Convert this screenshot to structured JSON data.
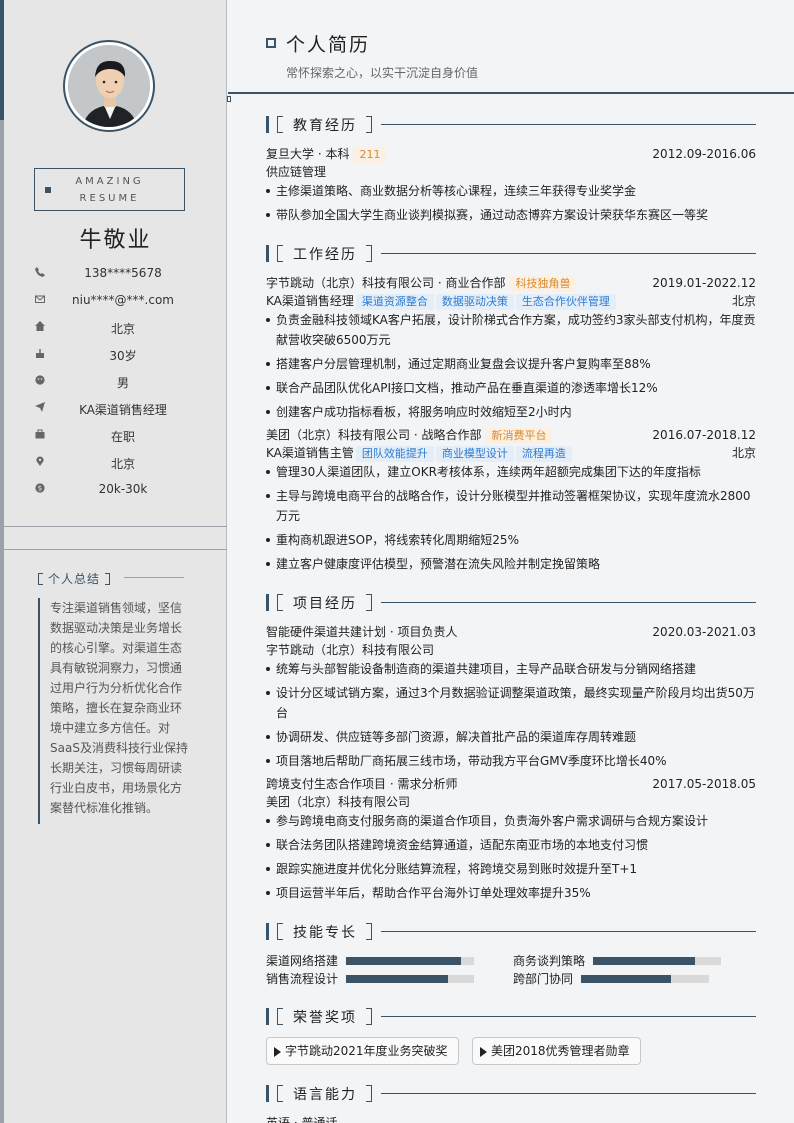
{
  "header": {
    "title": "个人简历",
    "subtitle": "常怀探索之心，以实干沉淀自身价值"
  },
  "sidebar": {
    "badge_line1": "AMAZING",
    "badge_line2": "RESUME",
    "name": "牛敬业",
    "info": [
      {
        "icon": "phone-icon",
        "value": "138****5678"
      },
      {
        "icon": "mail-icon",
        "value": "niu****@***.com"
      },
      {
        "icon": "home-icon",
        "value": "北京"
      },
      {
        "icon": "cake-icon",
        "value": "30岁"
      },
      {
        "icon": "face-icon",
        "value": "男"
      },
      {
        "icon": "send-icon",
        "value": "KA渠道销售经理"
      },
      {
        "icon": "briefcase-icon",
        "value": "在职"
      },
      {
        "icon": "location-pin-icon",
        "value": "北京"
      },
      {
        "icon": "money-icon",
        "value": "20k-30k"
      }
    ],
    "summary_title": "个人总结",
    "summary": "专注渠道销售领域，坚信数据驱动决策是业务增长的核心引擎。对渠道生态具有敏锐洞察力，习惯通过用户行为分析优化合作策略，擅长在复杂商业环境中建立多方信任。对SaaS及消费科技行业保持长期关注，习惯每周研读行业白皮书，用场景化方案替代标准化推销。"
  },
  "education": {
    "title": "教育经历",
    "school": "复旦大学 · 本科",
    "tag": "211",
    "date": "2012.09-2016.06",
    "major": "供应链管理",
    "bullets": [
      "主修渠道策略、商业数据分析等核心课程，连续三年获得专业奖学金",
      "带队参加全国大学生商业谈判模拟赛，通过动态博弈方案设计荣获华东赛区一等奖"
    ]
  },
  "work": {
    "title": "工作经历",
    "jobs": [
      {
        "company": "字节跳动（北京）科技有限公司 · 商业合作部",
        "tag": "科技独角兽",
        "date": "2019.01-2022.12",
        "role": "KA渠道销售经理",
        "skills": [
          "渠道资源整合",
          "数据驱动决策",
          "生态合作伙伴管理"
        ],
        "city": "北京",
        "bullets": [
          "负责金融科技领域KA客户拓展，设计阶梯式合作方案，成功签约3家头部支付机构，年度贡献营收突破6500万元",
          "搭建客户分层管理机制，通过定期商业复盘会议提升客户复购率至88%",
          "联合产品团队优化API接口文档，推动产品在垂直渠道的渗透率增长12%",
          "创建客户成功指标看板，将服务响应时效缩短至2小时内"
        ]
      },
      {
        "company": "美团（北京）科技有限公司 · 战略合作部",
        "tag": "新消费平台",
        "date": "2016.07-2018.12",
        "role": "KA渠道销售主管",
        "skills": [
          "团队效能提升",
          "商业模型设计",
          "流程再造"
        ],
        "city": "北京",
        "bullets": [
          "管理30人渠道团队，建立OKR考核体系，连续两年超额完成集团下达的年度指标",
          "主导与跨境电商平台的战略合作，设计分账模型并推动签署框架协议，实现年度流水2800万元",
          "重构商机跟进SOP，将线索转化周期缩短25%",
          "建立客户健康度评估模型，预警潜在流失风险并制定挽留策略"
        ]
      }
    ]
  },
  "projects": {
    "title": "项目经历",
    "items": [
      {
        "name": "智能硬件渠道共建计划 · 项目负责人",
        "date": "2020.03-2021.03",
        "org": "字节跳动（北京）科技有限公司",
        "bullets": [
          "统筹与头部智能设备制造商的渠道共建项目，主导产品联合研发与分销网络搭建",
          "设计分区域试销方案，通过3个月数据验证调整渠道政策，最终实现量产阶段月均出货50万台",
          "协调研发、供应链等多部门资源，解决首批产品的渠道库存周转难题",
          "项目落地后帮助厂商拓展三线市场，带动我方平台GMV季度环比增长40%"
        ]
      },
      {
        "name": "跨境支付生态合作项目 · 需求分析师",
        "date": "2017.05-2018.05",
        "org": "美团（北京）科技有限公司",
        "bullets": [
          "参与跨境电商支付服务商的渠道合作项目，负责海外客户需求调研与合规方案设计",
          "联合法务团队搭建跨境资金结算通道，适配东南亚市场的本地支付习惯",
          "跟踪实施进度并优化分账结算流程，将跨境交易到账时效提升至T+1",
          "项目运营半年后，帮助合作平台海外订单处理效率提升35%"
        ]
      }
    ]
  },
  "skills": {
    "title": "技能专长",
    "items": [
      {
        "name": "渠道网络搭建",
        "level": 0.9
      },
      {
        "name": "商务谈判策略",
        "level": 0.8
      },
      {
        "name": "销售流程设计",
        "level": 0.8
      },
      {
        "name": "跨部门协同",
        "level": 0.7
      }
    ]
  },
  "honors": {
    "title": "荣誉奖项",
    "items": [
      "字节跳动2021年度业务突破奖",
      "美团2018优秀管理者勋章"
    ]
  },
  "languages": {
    "title": "语言能力",
    "text": "英语 · 普通话"
  },
  "colors": {
    "accent": "#3a5366",
    "tag_orange": "#d98a2b",
    "tag_blue": "#2e7bcf"
  }
}
